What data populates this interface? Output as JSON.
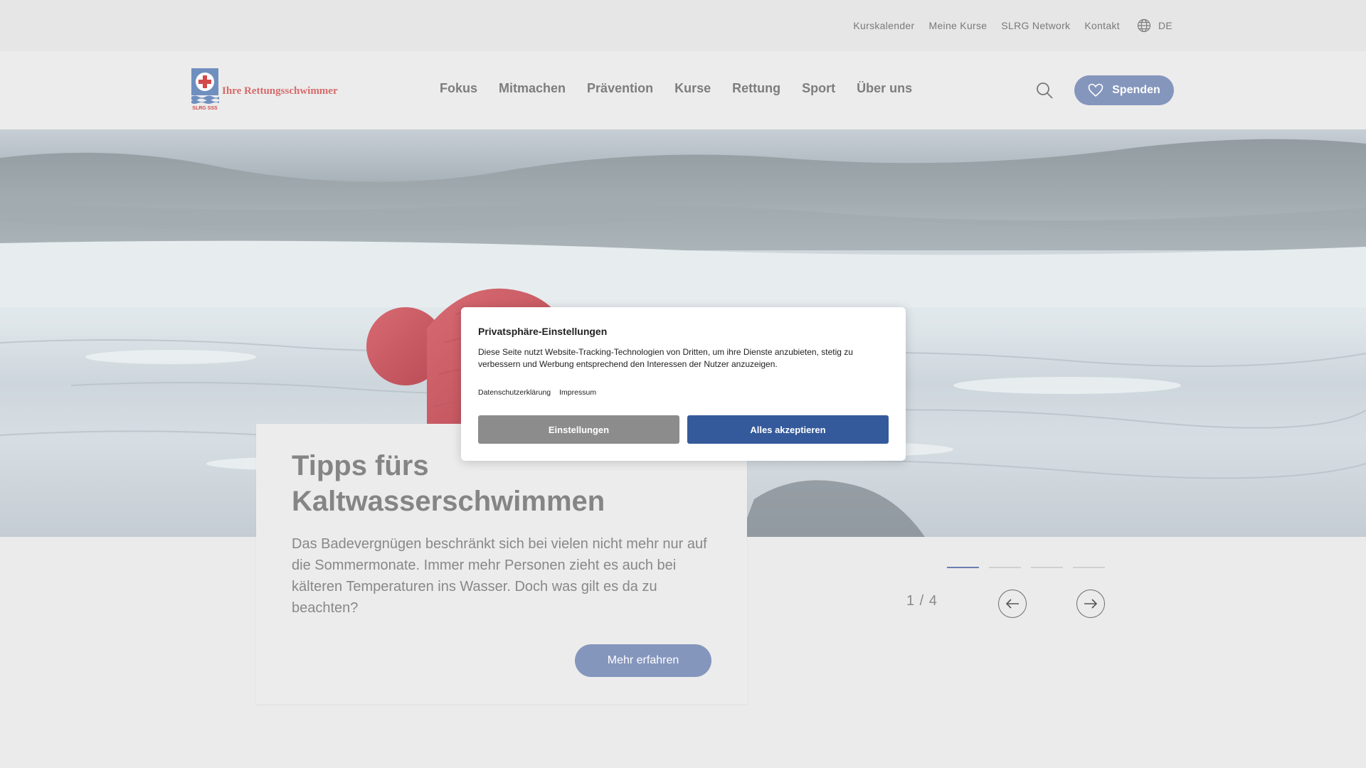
{
  "topbar": {
    "links": [
      "Kurskalender",
      "Meine Kurse",
      "SLRG Network",
      "Kontakt"
    ],
    "language": "DE",
    "language_icon": "globe-icon"
  },
  "header": {
    "logo_text": "Ihre Rettungsschwimmer",
    "logo_subtext": "SLRG SSS",
    "nav": [
      "Fokus",
      "Mitmachen",
      "Prävention",
      "Kurse",
      "Rettung",
      "Sport",
      "Über uns"
    ],
    "search_icon": "search-icon",
    "donate_label": "Spenden",
    "donate_icon": "heart-icon"
  },
  "slide": {
    "title": "Tipps fürs Kaltwasserschwimmen",
    "text": "Das Badevergnügen beschränkt sich bei vielen nicht mehr nur auf die Sommermonate. Immer mehr Personen zieht es auch bei kälteren Temperaturen ins Wasser. Doch was gilt es da zu beachten?",
    "cta_label": "Mehr erfahren"
  },
  "slider": {
    "counter": "1 / 4",
    "current": 1,
    "total": 4,
    "prev_icon": "arrow-left-icon",
    "next_icon": "arrow-right-icon"
  },
  "cookie": {
    "title": "Privatsphäre-Einstellungen",
    "description": "Diese Seite nutzt Website-Tracking-Technologien von Dritten, um ihre Dienste anzubieten, stetig zu verbessern und Werbung entsprechend den Interessen der Nutzer anzuzeigen.",
    "links": [
      "Datenschutzerklärung",
      "Impressum"
    ],
    "settings_label": "Einstellungen",
    "accept_label": "Alles akzeptieren"
  },
  "colors": {
    "accent": "#8596bd",
    "accept_button": "#345a9b",
    "settings_button": "#8c8c8c",
    "active_dot": "#6b7fb0",
    "logo_red": "#d66a6a"
  }
}
